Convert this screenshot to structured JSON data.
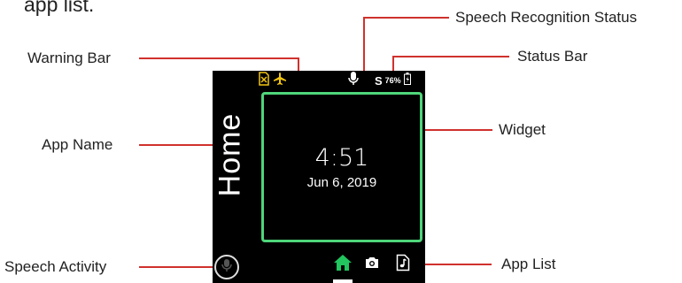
{
  "intro_text": "app list.",
  "labels": {
    "speech_status": "Speech Recognition Status",
    "warning_bar": "Warning Bar",
    "status_bar": "Status Bar",
    "widget": "Widget",
    "app_name": "App Name",
    "speech_activity": "Speech Activity",
    "app_list": "App List"
  },
  "screen": {
    "app_name": "Home",
    "clock_time": "4:51",
    "clock_date": "Jun 6, 2019",
    "status_letter": "S",
    "battery": "76%"
  },
  "colors": {
    "callout": "#d0312d",
    "widget_border": "#4fd67a",
    "home_icon": "#22c55e",
    "warning": "#f2c511"
  },
  "icons": [
    "sim-missing-icon",
    "airplane-icon",
    "microphone-icon",
    "battery-icon",
    "home-icon",
    "camera-icon",
    "music-file-icon",
    "speech-mic-icon"
  ]
}
